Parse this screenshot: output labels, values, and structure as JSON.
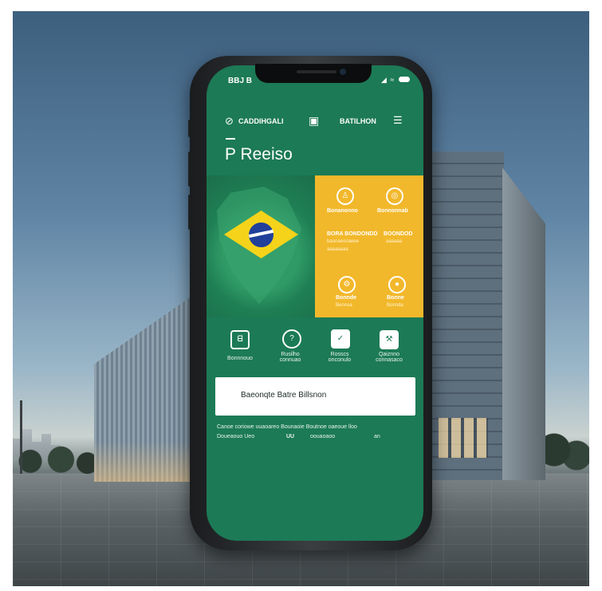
{
  "status_bar": {
    "time": "BBJ B",
    "icons": "◢ ≈"
  },
  "header": {
    "left_label": "CADDIHGALI",
    "right_label": "BATILHON",
    "title": "P Reeiso"
  },
  "yellow_panel": {
    "items": [
      {
        "icon": "person-icon",
        "label": "Bonanonno"
      },
      {
        "icon": "badge-icon",
        "label": "Bonnonnab"
      }
    ],
    "line_a": "BORA BONDONDD",
    "line_b": "BOONDOD",
    "sub_a": "baonaeonaeee",
    "sub_b": "aaaaaa",
    "sub_c": "aaaaaaaa",
    "bottom": [
      {
        "icon": "settings-icon",
        "label": "Bonnde",
        "sub": "Bennoa"
      },
      {
        "icon": "pin-icon",
        "label": "Bonne",
        "sub": "Bonnda"
      }
    ]
  },
  "quick_actions": [
    {
      "icon": "document-icon",
      "label": "Bonnnouo"
    },
    {
      "icon": "target-icon",
      "label": "Rusilho\nconnuao"
    },
    {
      "icon": "shield-icon",
      "label": "Rosscs\nonconulo"
    },
    {
      "icon": "tools-icon",
      "label": "Qaiznno\nconnasaco"
    }
  ],
  "info_card": {
    "text": "Baeonqte Batre Billsnon"
  },
  "footer": {
    "line1": "Canoe coriowe uuaoareo Bounaoie Boutnoe oaeoue lloo",
    "line2_a": "Doueaouo Ueo",
    "line2_b": "UU",
    "line2_c": "oouaoaoo",
    "line2_d": "an"
  },
  "colors": {
    "screen_green": "#1c7a56",
    "panel_yellow": "#f2b82b",
    "flag_yellow": "#f5d31a",
    "flag_blue": "#20409a"
  }
}
